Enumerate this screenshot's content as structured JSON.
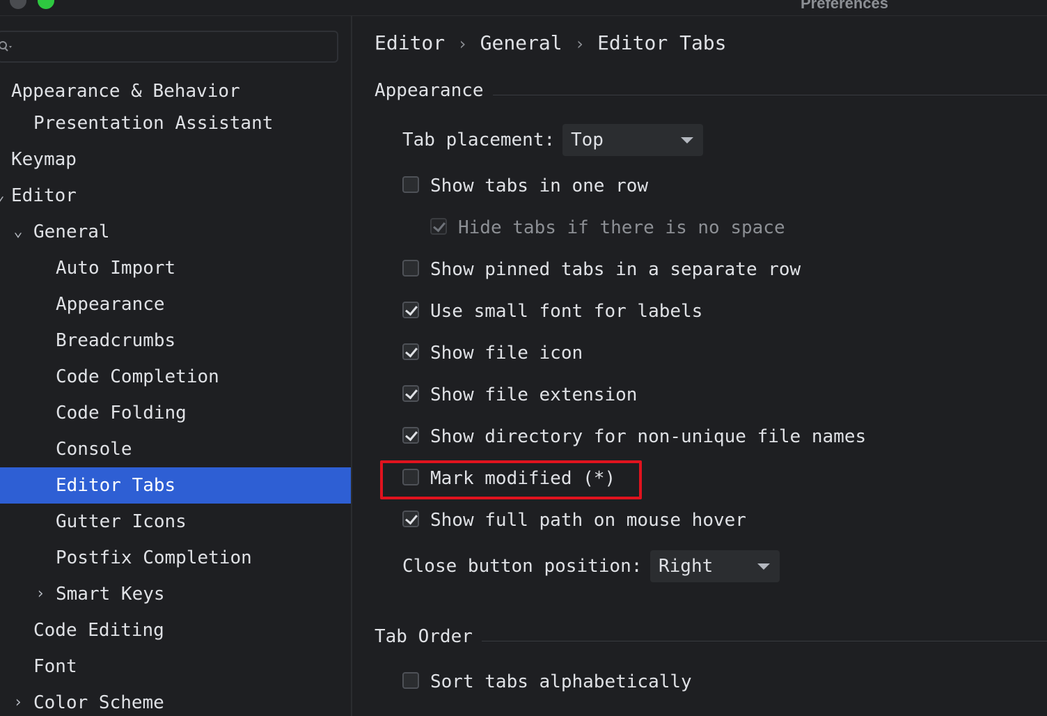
{
  "window": {
    "title": "Preferences"
  },
  "sidebar": {
    "search": {
      "placeholder": ""
    },
    "items": [
      {
        "label": "Appearance & Behavior"
      },
      {
        "label": "Presentation Assistant"
      },
      {
        "label": "Keymap"
      },
      {
        "label": "Editor"
      },
      {
        "label": "General"
      },
      {
        "label": "Auto Import"
      },
      {
        "label": "Appearance"
      },
      {
        "label": "Breadcrumbs"
      },
      {
        "label": "Code Completion"
      },
      {
        "label": "Code Folding"
      },
      {
        "label": "Console"
      },
      {
        "label": "Editor Tabs"
      },
      {
        "label": "Gutter Icons"
      },
      {
        "label": "Postfix Completion"
      },
      {
        "label": "Smart Keys"
      },
      {
        "label": "Code Editing"
      },
      {
        "label": "Font"
      },
      {
        "label": "Color Scheme"
      }
    ],
    "selected": "Editor Tabs"
  },
  "main": {
    "breadcrumb": [
      "Editor",
      "General",
      "Editor Tabs"
    ],
    "breadcrumb_sep": "›",
    "appearance": {
      "title": "Appearance",
      "tab_placement_label": "Tab placement:",
      "tab_placement_value": "Top",
      "options": [
        {
          "label": "Show tabs in one row",
          "checked": false
        },
        {
          "label": "Hide tabs if there is no space",
          "checked": true,
          "disabled": true
        },
        {
          "label": "Show pinned tabs in a separate row",
          "checked": false
        },
        {
          "label": "Use small font for labels",
          "checked": true
        },
        {
          "label": "Show file icon",
          "checked": true
        },
        {
          "label": "Show file extension",
          "checked": true
        },
        {
          "label": "Show directory for non-unique file names",
          "checked": true
        },
        {
          "label": "Mark modified (*)",
          "checked": false
        },
        {
          "label": "Show full path on mouse hover",
          "checked": true
        }
      ],
      "close_button_label": "Close button position:",
      "close_button_value": "Right"
    },
    "tab_order": {
      "title": "Tab Order",
      "options": [
        {
          "label": "Sort tabs alphabetically",
          "checked": false
        }
      ]
    }
  },
  "colors": {
    "background": "#1e1f22",
    "selection": "#2e5fd4",
    "highlight_box": "#e0131e",
    "traffic_green": "#2ec840"
  }
}
